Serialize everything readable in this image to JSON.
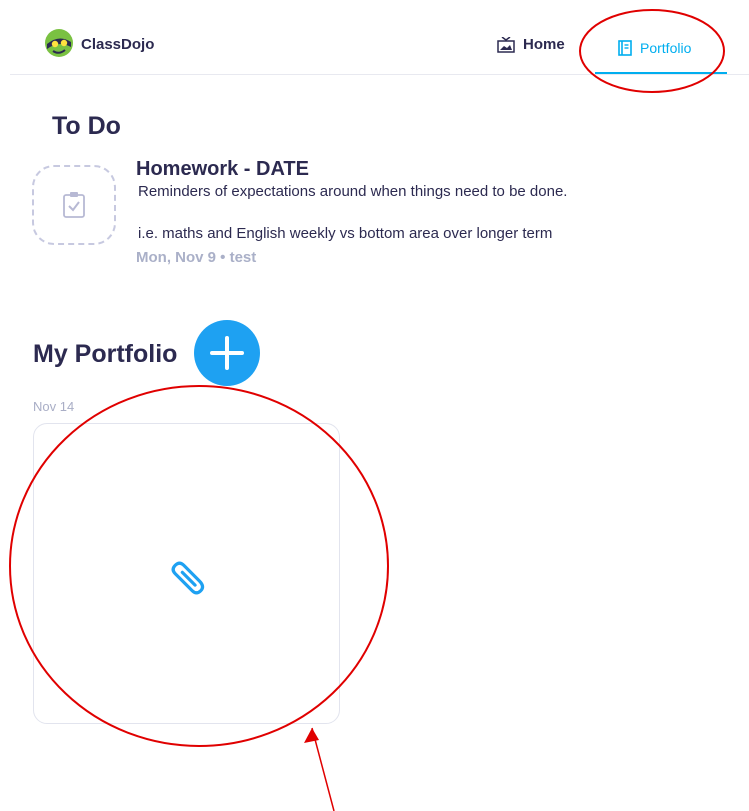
{
  "header": {
    "brand": "ClassDojo",
    "logo_icon": "classdojo-logo-icon",
    "nav": [
      {
        "label": "Home",
        "icon": "home-icon",
        "active": false
      },
      {
        "label": "Portfolio",
        "icon": "portfolio-book-icon",
        "active": true
      }
    ]
  },
  "todo": {
    "heading": "To Do",
    "item": {
      "icon": "clipboard-check-icon",
      "title": "Homework - DATE",
      "desc_line1": "Reminders of expectations around when things need to be done.",
      "desc_line2": "i.e. maths and English weekly vs bottom area over longer term",
      "meta": "Mon, Nov 9  •  test"
    }
  },
  "portfolio": {
    "heading": "My Portfolio",
    "add_button_icon": "plus-icon",
    "date": "Nov 14",
    "card_icon": "paperclip-icon"
  },
  "colors": {
    "accent": "#00aeef",
    "add_button": "#1ea1f2",
    "text_dark": "#2c2a50",
    "text_muted": "#aab0c8",
    "annotation_red": "#e00000"
  }
}
